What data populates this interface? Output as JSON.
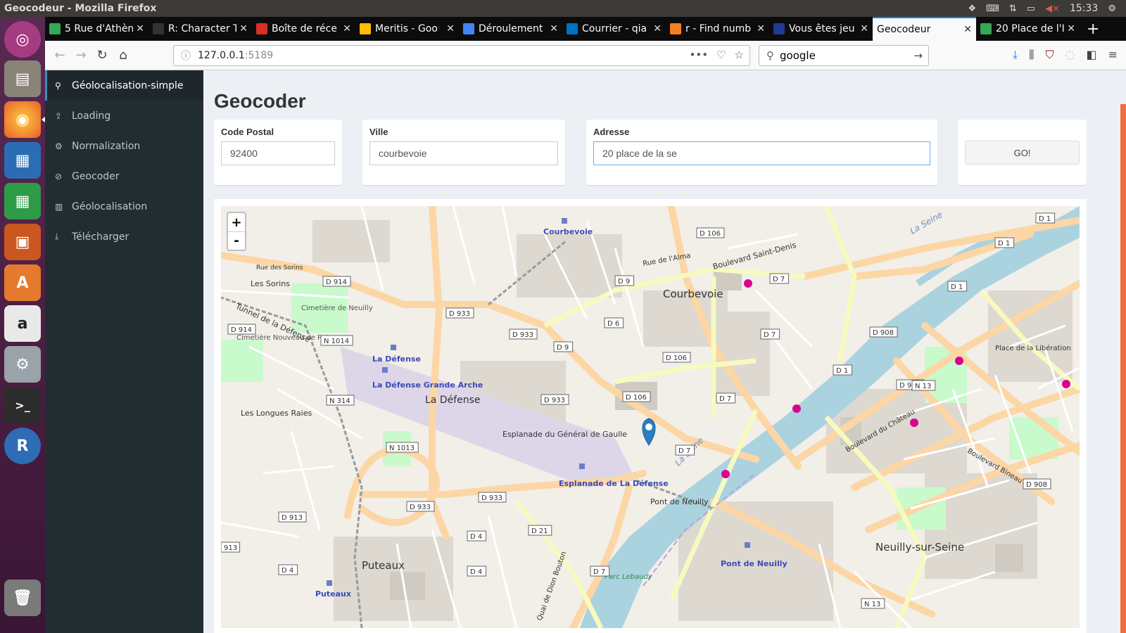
{
  "window_title": "Geocodeur - Mozilla Firefox",
  "tray": {
    "time": "15:33"
  },
  "tabs": [
    {
      "label": "5 Rue d'Athèn",
      "favicon_color": "#34a853",
      "icon": "maps-icon"
    },
    {
      "label": "R: Character T",
      "favicon_color": "#333333",
      "icon": "r-docs-icon"
    },
    {
      "label": "Boîte de réce",
      "favicon_color": "#d93025",
      "icon": "gmail-icon"
    },
    {
      "label": "Meritis - Goo",
      "favicon_color": "#fbbc04",
      "icon": "drive-icon"
    },
    {
      "label": "Déroulement",
      "favicon_color": "#4285f4",
      "icon": "docs-icon"
    },
    {
      "label": "Courrier - qia",
      "favicon_color": "#0072c6",
      "icon": "outlook-icon"
    },
    {
      "label": "r - Find numb",
      "favicon_color": "#f48024",
      "icon": "stackoverflow-icon"
    },
    {
      "label": "Vous êtes jeu",
      "favicon_color": "#1f3a93",
      "icon": "french-flag-icon"
    },
    {
      "label": "Geocodeur",
      "favicon_color": "",
      "icon": ""
    },
    {
      "label": "20 Place de l'I",
      "favicon_color": "#34a853",
      "icon": "maps-icon"
    }
  ],
  "url": {
    "host": "127.0.0.1",
    "port": ":5189"
  },
  "search": {
    "value": "google"
  },
  "sidebar": {
    "items": [
      {
        "label": "Géolocalisation-simple",
        "icon": "map-marker-icon",
        "glyph": "⚲"
      },
      {
        "label": "Loading",
        "icon": "upload-icon",
        "glyph": "⇪"
      },
      {
        "label": "Normalization",
        "icon": "gear-icon",
        "glyph": "⚙"
      },
      {
        "label": "Geocoder",
        "icon": "compass-icon",
        "glyph": "⊘"
      },
      {
        "label": "Géolocalisation",
        "icon": "map-icon",
        "glyph": "▥"
      },
      {
        "label": "Télécharger",
        "icon": "download-icon",
        "glyph": "⤓"
      }
    ]
  },
  "page": {
    "title": "Geocoder"
  },
  "form": {
    "code_postal": {
      "label": "Code Postal",
      "value": "92400"
    },
    "ville": {
      "label": "Ville",
      "value": "courbevoie"
    },
    "adresse": {
      "label": "Adresse",
      "value": "20 place de la se"
    },
    "go_label": "GO!"
  },
  "map": {
    "zoom_in": "+",
    "zoom_out": "-",
    "labels": {
      "courbevoie_main": "Courbevoie",
      "courbevoie_station": "Courbevoie",
      "la_defense": "La Défense",
      "la_defense_station": "La Défense",
      "grande_arche": "La Défense Grande Arche",
      "esplanade_gaulle": "Esplanade du Général de Gaulle",
      "esplanade_defense": "Esplanade de La Défense",
      "pont_neuilly": "Pont de Neuilly",
      "pont_neuilly_station": "Pont de Neuilly",
      "neuilly": "Neuilly-sur-Seine",
      "puteaux": "Puteaux",
      "puteaux_station": "Puteaux",
      "la_seine_1": "La Seine",
      "la_seine_2": "La Seine",
      "les_sorins": "Les Sorins",
      "longues_raies": "Les Longues Raies",
      "cimetiere_neuilly": "Cimetière de Neuilly",
      "cimetiere_puteaux": "Cimetière Nouveau de Puteaux",
      "place_liberation": "Place de la Libération",
      "parc_lebaudy": "Parc Lebaudy",
      "bd_saint_denis": "Boulevard Saint-Denis",
      "rue_alma": "Rue de l'Alma",
      "bd_bineau": "Boulevard Bineau",
      "bd_chateau": "Boulevard du Château",
      "tunnel": "Tunnel de la Défense",
      "bd_dion_bouton": "Quai de Dion Bouton",
      "rue_sorins": "Rue des Sorins"
    },
    "road_badges": [
      "D 933",
      "D 933",
      "D 933",
      "D 933",
      "D 933",
      "D 914",
      "D 914",
      "N 1014",
      "N 314",
      "N 1013",
      "D 913",
      "D 4",
      "D 4",
      "D 4",
      "D 21",
      "D 7",
      "D 7",
      "D 7",
      "D 7",
      "D 7",
      "D 106",
      "D 106",
      "D 106",
      "D 9",
      "D 9",
      "D 6",
      "D 1",
      "D 1",
      "D 1",
      "D 1",
      "D 908",
      "D 908",
      "D 908",
      "N 13",
      "N 13",
      "913"
    ]
  },
  "colors": {
    "accent": "#3c8dbc",
    "sidebar": "#222d32",
    "marker": "#2b7ec1",
    "river": "#aad3df",
    "major_road": "#fcd6a4",
    "road_yellow": "#f7fabf",
    "park": "#c8facc"
  }
}
